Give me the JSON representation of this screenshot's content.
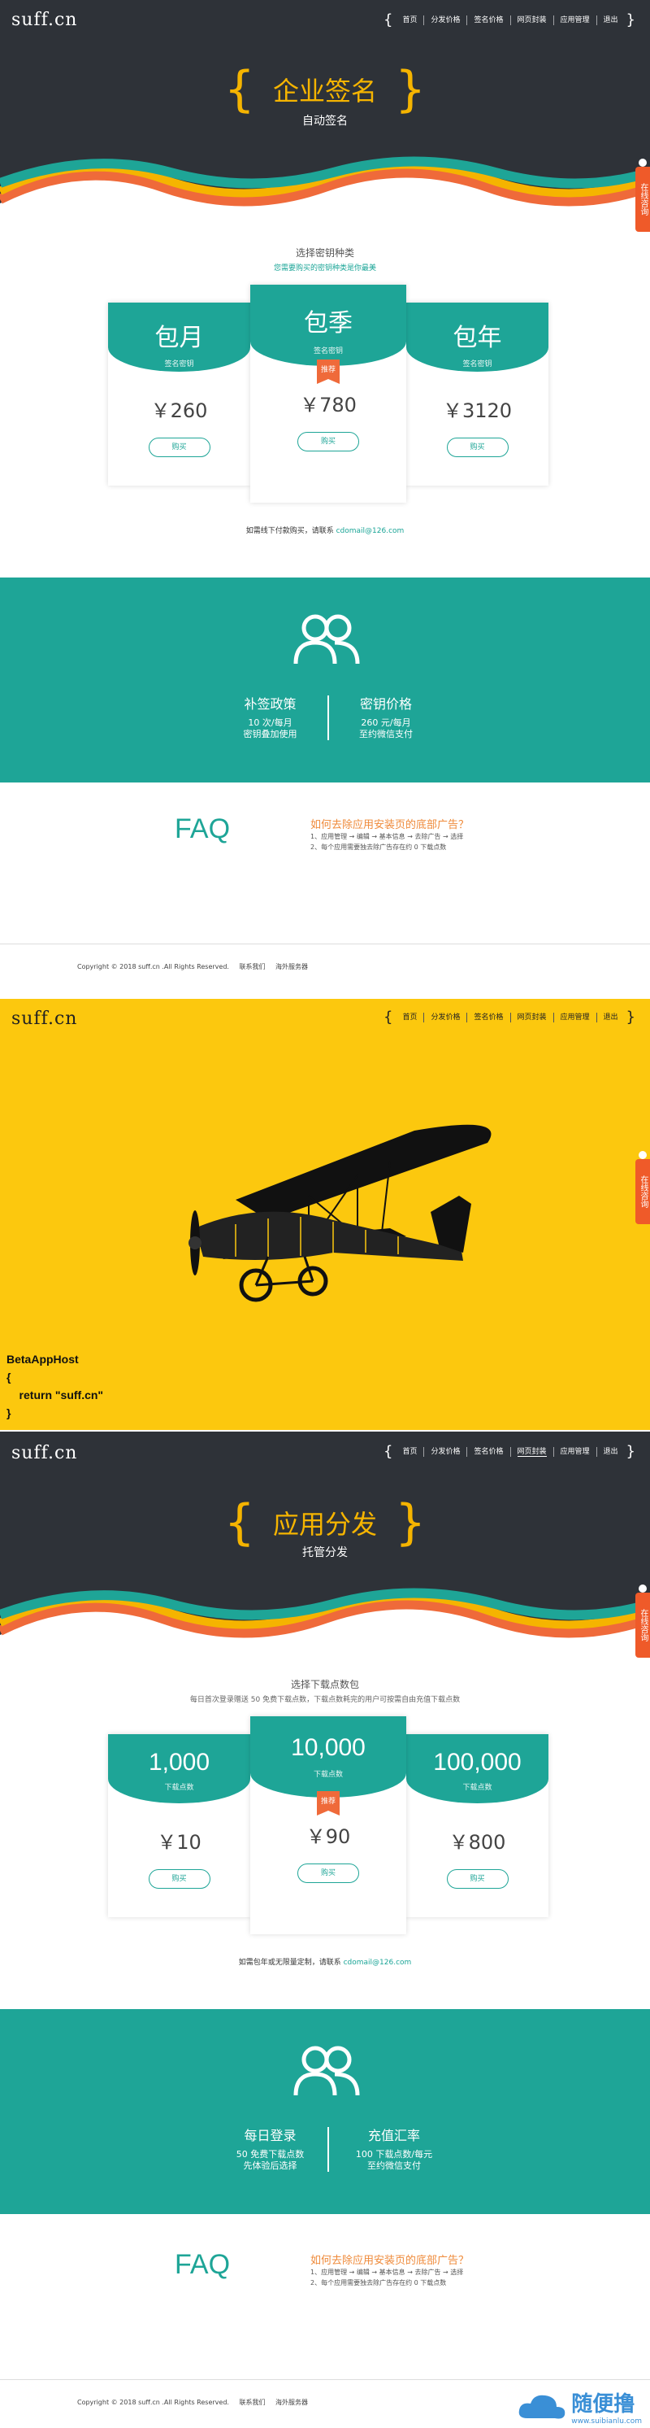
{
  "logo": "suff.cn",
  "nav_brace": "{",
  "nav_close": "}",
  "nav_sec1": [
    "首页",
    "分发价格",
    "签名价格",
    "网页封装",
    "应用管理",
    "退出"
  ],
  "nav_sec2": [
    "首页",
    "分发价格",
    "签名价格",
    "网页封装",
    "应用管理",
    "退出"
  ],
  "nav_sec3": [
    "首页",
    "分发价格",
    "签名价格",
    "网页封装",
    "应用管理",
    "退出"
  ],
  "side_tab": "在线咨询",
  "section1": {
    "title": "企业签名",
    "subtitle": "自动签名",
    "choose_title": "选择密钥种类",
    "choose_sub": "您需要购买的密钥种类是你最美",
    "plans": [
      {
        "name": "包月",
        "unit": "签名密钥",
        "price": "￥260",
        "buy": "购买"
      },
      {
        "name": "包季",
        "unit": "签名密钥",
        "price": "￥780",
        "buy": "购买",
        "ribbon": "推荐"
      },
      {
        "name": "包年",
        "unit": "签名密钥",
        "price": "￥3120",
        "buy": "购买"
      }
    ],
    "contact_text": "如需线下付款购买，请联系",
    "contact_email": "cdomail@126.com",
    "policy": {
      "left_title": "补签政策",
      "left_lines": [
        "10 次/每月",
        "密钥叠加使用"
      ],
      "right_title": "密钥价格",
      "right_lines": [
        "260 元/每月",
        "至约微信支付"
      ]
    },
    "faq": "FAQ",
    "faq_q": "如何去除应用安装页的底部广告？",
    "faq_a": [
      "1、应用管理 → 编辑 → 基本信息 → 去除广告 → 选择",
      "2、每个应用需要独去除广告存在约 0 下载点数"
    ]
  },
  "footer": {
    "copyright": "Copyright © 2018 suff.cn .All Rights Reserved.",
    "link1": "联系我们",
    "link2": "海外服务器"
  },
  "section2": {
    "code_lines": [
      "BetaAppHost",
      "{",
      "    return \"suff.cn\"",
      "}"
    ]
  },
  "section3": {
    "title": "应用分发",
    "subtitle": "托管分发",
    "choose_title": "选择下载点数包",
    "choose_sub": "每日首次登录赠送 50 免费下载点数，下载点数耗完的用户可按需自由充值下载点数",
    "plans": [
      {
        "name": "1,000",
        "unit": "下载点数",
        "price": "￥10",
        "buy": "购买"
      },
      {
        "name": "10,000",
        "unit": "下载点数",
        "price": "￥90",
        "buy": "购买",
        "ribbon": "推荐"
      },
      {
        "name": "100,000",
        "unit": "下载点数",
        "price": "￥800",
        "buy": "购买"
      }
    ],
    "contact_text": "如需包年或无限量定制，请联系",
    "contact_email": "cdomail@126.com",
    "policy": {
      "left_title": "每日登录",
      "left_lines": [
        "50 免费下载点数",
        "先体验后选择"
      ],
      "right_title": "充值汇率",
      "right_lines": [
        "100 下载点数/每元",
        "至约微信支付"
      ]
    },
    "faq": "FAQ",
    "faq_q": "如何去除应用安装页的底部广告？",
    "faq_a": [
      "1、应用管理 → 编辑 → 基本信息 → 去除广告 → 选择",
      "2、每个应用需要独去除广告存在约 0 下载点数"
    ]
  },
  "watermark": "随便撸",
  "watermark_url": "www.suibianlu.com",
  "colors": {
    "dark": "#2e3238",
    "teal": "#1ea597",
    "yellow": "#fcc80e",
    "orange": "#ef6a3a",
    "gold": "#f5b400"
  }
}
